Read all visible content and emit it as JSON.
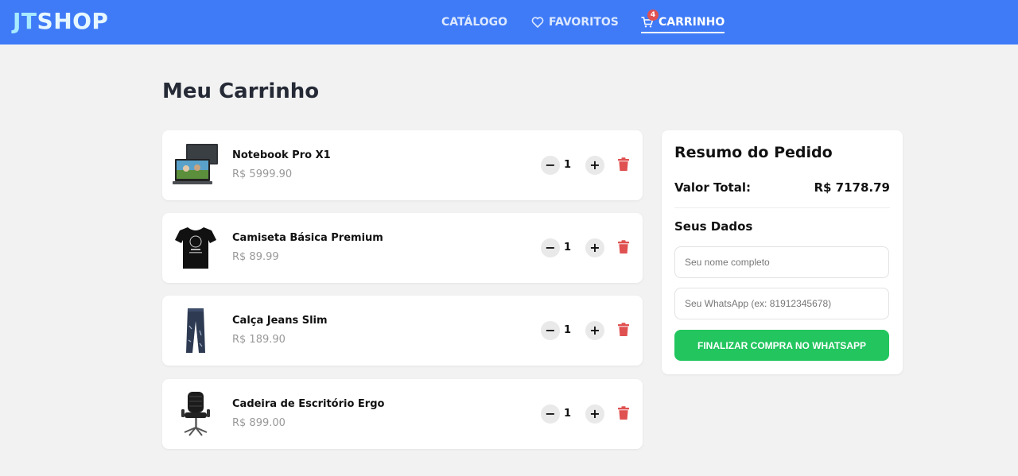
{
  "brand": {
    "part1": "JT",
    "part2": "SHOP"
  },
  "nav": {
    "catalog": "CATÁLOGO",
    "favorites": "FAVORITOS",
    "cart": "CARRINHO",
    "cart_count": "4",
    "favorites_icon": "heart-icon",
    "cart_icon": "cart-icon"
  },
  "page": {
    "title": "Meu Carrinho"
  },
  "cart": {
    "items": [
      {
        "name": "Notebook Pro X1",
        "price": "R$ 5999.90",
        "qty": "1",
        "minus": "−",
        "plus": "+",
        "image": "laptop"
      },
      {
        "name": "Camiseta Básica Premium",
        "price": "R$ 89.99",
        "qty": "1",
        "minus": "−",
        "plus": "+",
        "image": "t-shirt"
      },
      {
        "name": "Calça Jeans Slim",
        "price": "R$ 189.90",
        "qty": "1",
        "minus": "−",
        "plus": "+",
        "image": "jeans"
      },
      {
        "name": "Cadeira de Escritório Ergo",
        "price": "R$ 899.00",
        "qty": "1",
        "minus": "−",
        "plus": "+",
        "image": "office-chair"
      }
    ]
  },
  "summary": {
    "title": "Resumo do Pedido",
    "total_label": "Valor Total:",
    "total_value": "R$ 7178.79",
    "data_title": "Seus Dados",
    "name_placeholder": "Seu nome completo",
    "whatsapp_placeholder": "Seu WhatsApp (ex: 81912345678)",
    "checkout_label": "FINALIZAR COMPRA NO WHATSAPP"
  },
  "colors": {
    "navbar": "#3f7bf7",
    "checkout": "#22c55e",
    "trash": "#e05151",
    "badge": "#e05151"
  }
}
